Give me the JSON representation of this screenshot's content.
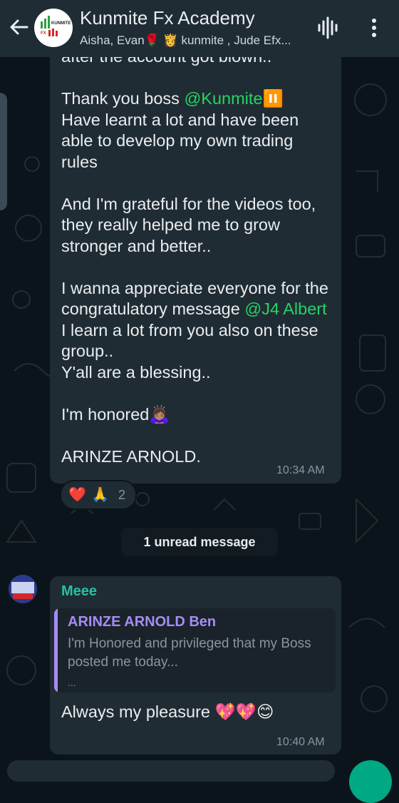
{
  "header": {
    "title": "Kunmite Fx Academy",
    "subtitle": "Aisha, Evan🌹 👸 kunmite , Jude Efx...",
    "avatar_text": "KUNMITE FX"
  },
  "message1": {
    "partial_top": "after the account got blown..",
    "p1_prefix": "Thank you boss ",
    "p1_mention": "@Kunmite",
    "p1_emoji": "⏸️",
    "p1_rest": "Have learnt a lot and have been able to develop my own trading rules",
    "p2": "And I'm grateful for the videos too, they really helped me to grow stronger and better..",
    "p3_prefix": "I wanna appreciate everyone for the congratulatory message ",
    "p3_mention": "@J4 Albert",
    "p3_rest": " I learn a lot from you also on these group..",
    "p3_line2": "Y'all are a blessing..",
    "p4": "I'm honored🙇🏽‍♀️",
    "p5": "ARINZE ARNOLD.",
    "time": "10:34 AM",
    "reactions": [
      "❤️",
      "🙏"
    ],
    "reaction_count": "2"
  },
  "unread_banner": "1 unread message",
  "message2": {
    "sender": "Meee",
    "quote_author": "ARINZE ARNOLD Ben",
    "quote_text": "I'm Honored and privileged that my Boss posted me today...",
    "quote_more": "...",
    "text": "Always my pleasure 💖💖😊",
    "time": "10:40 AM"
  },
  "colors": {
    "background": "#0b141a",
    "bubble": "#202c33",
    "header": "#1f2c34",
    "mention": "#25d366",
    "quote_accent": "#a68cf5",
    "sender_name": "#25c2a0"
  }
}
